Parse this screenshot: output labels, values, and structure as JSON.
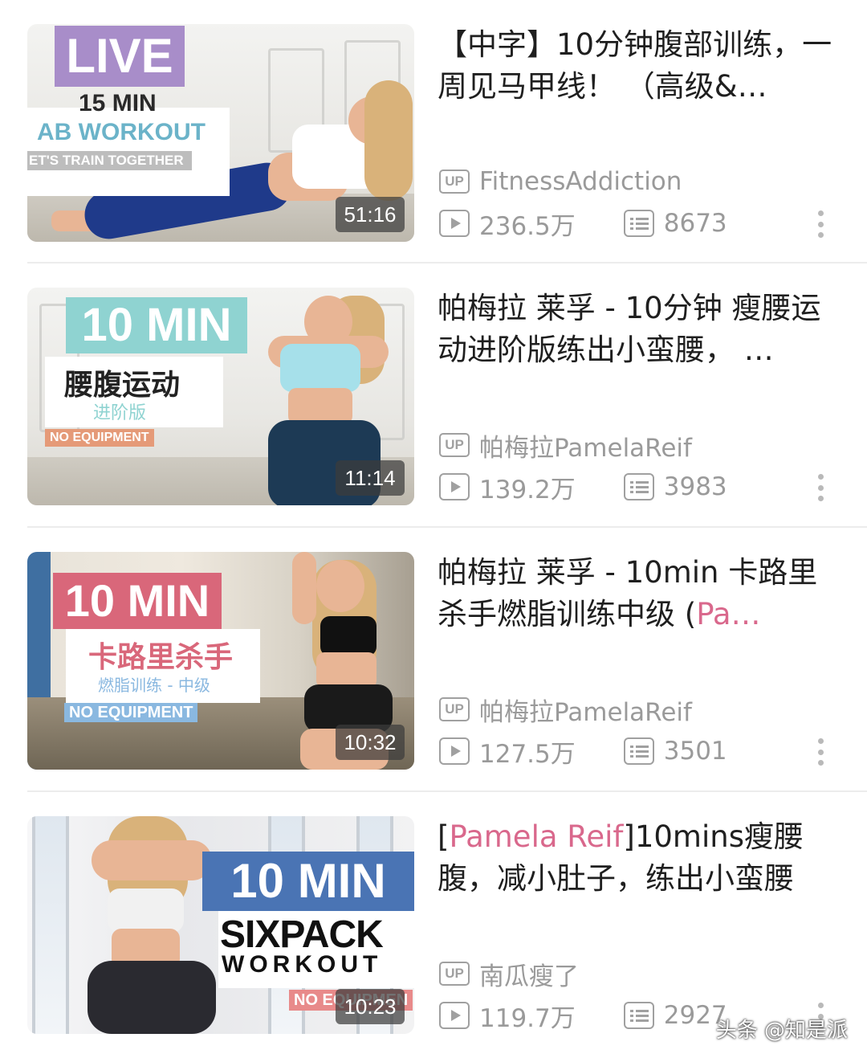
{
  "videos": [
    {
      "thumb": {
        "line1": "LIVE",
        "line2": "15 MIN",
        "line3": "AB WORKOUT",
        "line4": "ET'S TRAIN TOGETHER",
        "duration": "51:16"
      },
      "title_before": "【中字】10分钟腹部训练，一周见马甲线！ （高级&…",
      "title_highlight": "",
      "title_after": "",
      "uploader": "FitnessAddiction",
      "views": "236.5万",
      "danmaku": "8673"
    },
    {
      "thumb": {
        "line1": "10 MIN",
        "line2": "腰腹运动",
        "line3": "进阶版",
        "line4": "NO EQUIPMENT",
        "duration": "11:14"
      },
      "title_before": "帕梅拉 莱孚 - 10分钟 瘦腰运动进阶版练出小蛮腰， …",
      "title_highlight": "",
      "title_after": "",
      "uploader": "帕梅拉PamelaReif",
      "views": "139.2万",
      "danmaku": "3983"
    },
    {
      "thumb": {
        "line1": "10 MIN",
        "line2": "卡路里杀手",
        "line3": "燃脂训练 - 中级",
        "line4": "NO EQUIPMENT",
        "duration": "10:32"
      },
      "title_before": "帕梅拉 莱孚 - 10min 卡路里杀手燃脂训练中级 (",
      "title_highlight": "Pa…",
      "title_after": "",
      "uploader": "帕梅拉PamelaReif",
      "views": "127.5万",
      "danmaku": "3501"
    },
    {
      "thumb": {
        "line1": "10 MIN",
        "line2": "SIXPACK",
        "line3": "WORKOUT",
        "line4": "NO EQUIPMEN",
        "duration": "10:23"
      },
      "title_before": "[",
      "title_highlight": "Pamela Reif",
      "title_after": "]10mins瘦腰腹，减小肚子，练出小蛮腰",
      "uploader": "南瓜瘦了",
      "views": "119.7万",
      "danmaku": "2927"
    }
  ],
  "up_label": "UP",
  "watermark": "头条 @知是派",
  "icons": {
    "uploader": "up-badge-icon",
    "views": "play-count-icon",
    "danmaku": "danmaku-icon",
    "more": "more-vertical-icon"
  },
  "colors": {
    "highlight": "#d9688c",
    "meta_text": "#9a9a9a"
  }
}
